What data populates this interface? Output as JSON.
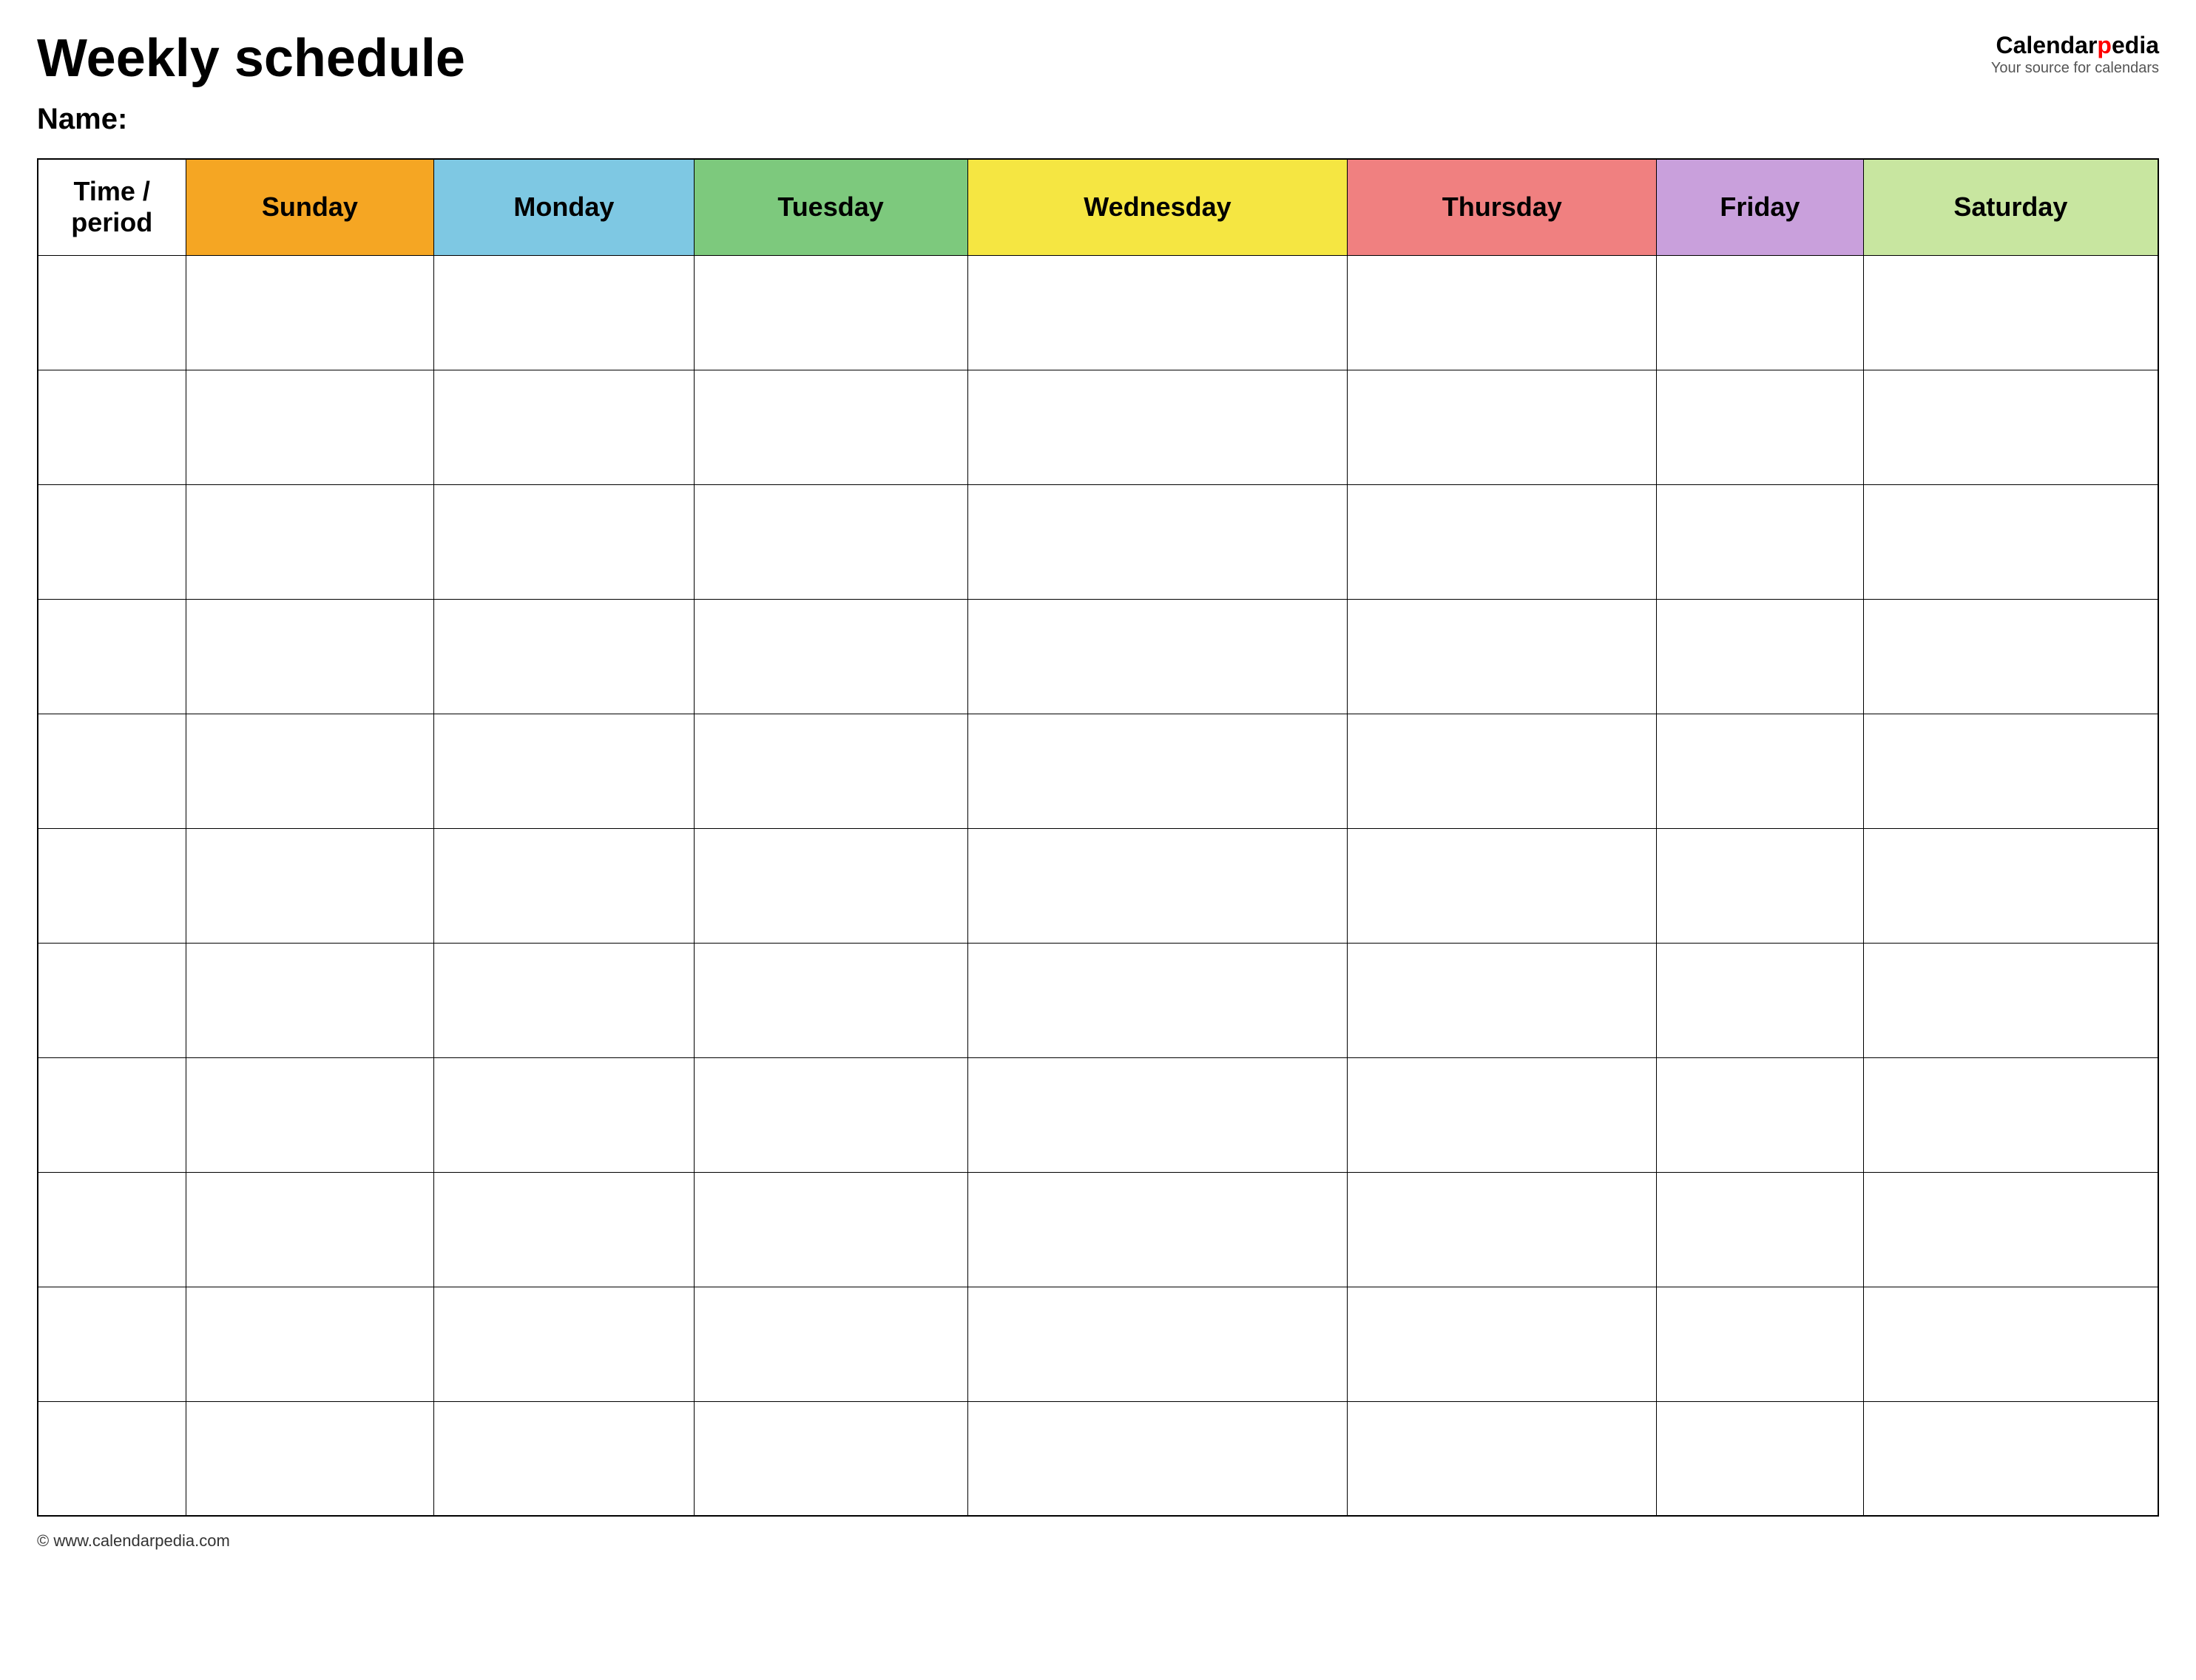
{
  "page": {
    "title": "Weekly schedule",
    "name_label": "Name:",
    "logo": {
      "brand_part1": "Calendar",
      "brand_part2": "pedia",
      "tagline": "Your source for calendars"
    },
    "footer_url": "www.calendarpedia.com"
  },
  "table": {
    "headers": [
      {
        "label": "Time / period",
        "class": "col-time time-header"
      },
      {
        "label": "Sunday",
        "class": "col-sunday"
      },
      {
        "label": "Monday",
        "class": "col-monday"
      },
      {
        "label": "Tuesday",
        "class": "col-tuesday"
      },
      {
        "label": "Wednesday",
        "class": "col-wednesday"
      },
      {
        "label": "Thursday",
        "class": "col-thursday"
      },
      {
        "label": "Friday",
        "class": "col-friday"
      },
      {
        "label": "Saturday",
        "class": "col-saturday"
      }
    ],
    "row_count": 11
  }
}
